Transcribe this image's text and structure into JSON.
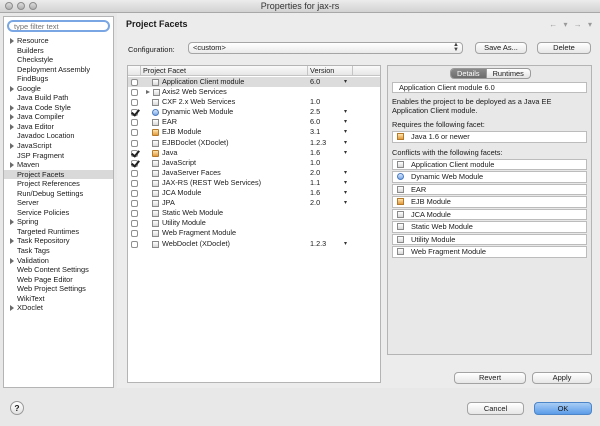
{
  "window": {
    "title": "Properties for jax-rs"
  },
  "sidebar": {
    "filter_placeholder": "type filter text",
    "items": [
      {
        "label": "Resource",
        "expandable": true
      },
      {
        "label": "Builders",
        "expandable": false
      },
      {
        "label": "Checkstyle",
        "expandable": false
      },
      {
        "label": "Deployment Assembly",
        "expandable": false
      },
      {
        "label": "FindBugs",
        "expandable": false
      },
      {
        "label": "Google",
        "expandable": true
      },
      {
        "label": "Java Build Path",
        "expandable": false
      },
      {
        "label": "Java Code Style",
        "expandable": true
      },
      {
        "label": "Java Compiler",
        "expandable": true
      },
      {
        "label": "Java Editor",
        "expandable": true
      },
      {
        "label": "Javadoc Location",
        "expandable": false
      },
      {
        "label": "JavaScript",
        "expandable": true
      },
      {
        "label": "JSP Fragment",
        "expandable": false
      },
      {
        "label": "Maven",
        "expandable": true
      },
      {
        "label": "Project Facets",
        "expandable": false,
        "selected": true
      },
      {
        "label": "Project References",
        "expandable": false
      },
      {
        "label": "Run/Debug Settings",
        "expandable": false
      },
      {
        "label": "Server",
        "expandable": false
      },
      {
        "label": "Service Policies",
        "expandable": false
      },
      {
        "label": "Spring",
        "expandable": true
      },
      {
        "label": "Targeted Runtimes",
        "expandable": false
      },
      {
        "label": "Task Repository",
        "expandable": true
      },
      {
        "label": "Task Tags",
        "expandable": false
      },
      {
        "label": "Validation",
        "expandable": true
      },
      {
        "label": "Web Content Settings",
        "expandable": false
      },
      {
        "label": "Web Page Editor",
        "expandable": false
      },
      {
        "label": "Web Project Settings",
        "expandable": false
      },
      {
        "label": "WikiText",
        "expandable": false
      },
      {
        "label": "XDoclet",
        "expandable": true
      }
    ]
  },
  "main": {
    "title": "Project Facets",
    "nav_arrows": "← ▾ → ▾",
    "configuration": {
      "label": "Configuration:",
      "value": "<custom>",
      "save_as_label": "Save As...",
      "delete_label": "Delete"
    },
    "facets": {
      "columns": {
        "name": "Project Facet",
        "version": "Version"
      },
      "rows": [
        {
          "name": "Application Client module",
          "version": "6.0",
          "checked": false,
          "dropdown": true,
          "expandable": false,
          "icon": "module",
          "selected": true
        },
        {
          "name": "Axis2 Web Services",
          "version": "",
          "checked": false,
          "dropdown": false,
          "expandable": true,
          "icon": "folder"
        },
        {
          "name": "CXF 2.x Web Services",
          "version": "1.0",
          "checked": false,
          "dropdown": false,
          "expandable": false,
          "icon": "module"
        },
        {
          "name": "Dynamic Web Module",
          "version": "2.5",
          "checked": true,
          "dropdown": true,
          "expandable": false,
          "icon": "web"
        },
        {
          "name": "EAR",
          "version": "6.0",
          "checked": false,
          "dropdown": true,
          "expandable": false,
          "icon": "module"
        },
        {
          "name": "EJB Module",
          "version": "3.1",
          "checked": false,
          "dropdown": true,
          "expandable": false,
          "icon": "java"
        },
        {
          "name": "EJBDoclet (XDoclet)",
          "version": "1.2.3",
          "checked": false,
          "dropdown": true,
          "expandable": false,
          "icon": "module"
        },
        {
          "name": "Java",
          "version": "1.6",
          "checked": true,
          "dropdown": true,
          "expandable": false,
          "icon": "java"
        },
        {
          "name": "JavaScript",
          "version": "1.0",
          "checked": true,
          "dropdown": false,
          "expandable": false,
          "icon": "module"
        },
        {
          "name": "JavaServer Faces",
          "version": "2.0",
          "checked": false,
          "dropdown": true,
          "expandable": false,
          "icon": "module"
        },
        {
          "name": "JAX-RS (REST Web Services)",
          "version": "1.1",
          "checked": false,
          "dropdown": true,
          "expandable": false,
          "icon": "module"
        },
        {
          "name": "JCA Module",
          "version": "1.6",
          "checked": false,
          "dropdown": true,
          "expandable": false,
          "icon": "module"
        },
        {
          "name": "JPA",
          "version": "2.0",
          "checked": false,
          "dropdown": true,
          "expandable": false,
          "icon": "module"
        },
        {
          "name": "Static Web Module",
          "version": "",
          "checked": false,
          "dropdown": false,
          "expandable": false,
          "icon": "module"
        },
        {
          "name": "Utility Module",
          "version": "",
          "checked": false,
          "dropdown": false,
          "expandable": false,
          "icon": "module"
        },
        {
          "name": "Web Fragment Module",
          "version": "",
          "checked": false,
          "dropdown": false,
          "expandable": false,
          "icon": "module"
        },
        {
          "name": "WebDoclet (XDoclet)",
          "version": "1.2.3",
          "checked": false,
          "dropdown": true,
          "expandable": false,
          "icon": "module"
        }
      ]
    },
    "details": {
      "tabs": [
        {
          "label": "Details",
          "active": true
        },
        {
          "label": "Runtimes",
          "active": false
        }
      ],
      "facet_title": "Application Client module 6.0",
      "description": "Enables the project to be deployed as a Java EE Application Client module.",
      "requires_label": "Requires the following facet:",
      "requires": [
        {
          "label": "Java 1.6 or newer",
          "icon": "java"
        }
      ],
      "conflicts_label": "Conflicts with the following facets:",
      "conflicts": [
        {
          "label": "Application Client module",
          "icon": "module"
        },
        {
          "label": "Dynamic Web Module",
          "icon": "web"
        },
        {
          "label": "EAR",
          "icon": "module"
        },
        {
          "label": "EJB Module",
          "icon": "java"
        },
        {
          "label": "JCA Module",
          "icon": "module"
        },
        {
          "label": "Static Web Module",
          "icon": "module"
        },
        {
          "label": "Utility Module",
          "icon": "module"
        },
        {
          "label": "Web Fragment Module",
          "icon": "module"
        }
      ]
    },
    "revert_label": "Revert",
    "apply_label": "Apply"
  },
  "footer": {
    "help_icon": "?",
    "cancel_label": "Cancel",
    "ok_label": "OK"
  }
}
